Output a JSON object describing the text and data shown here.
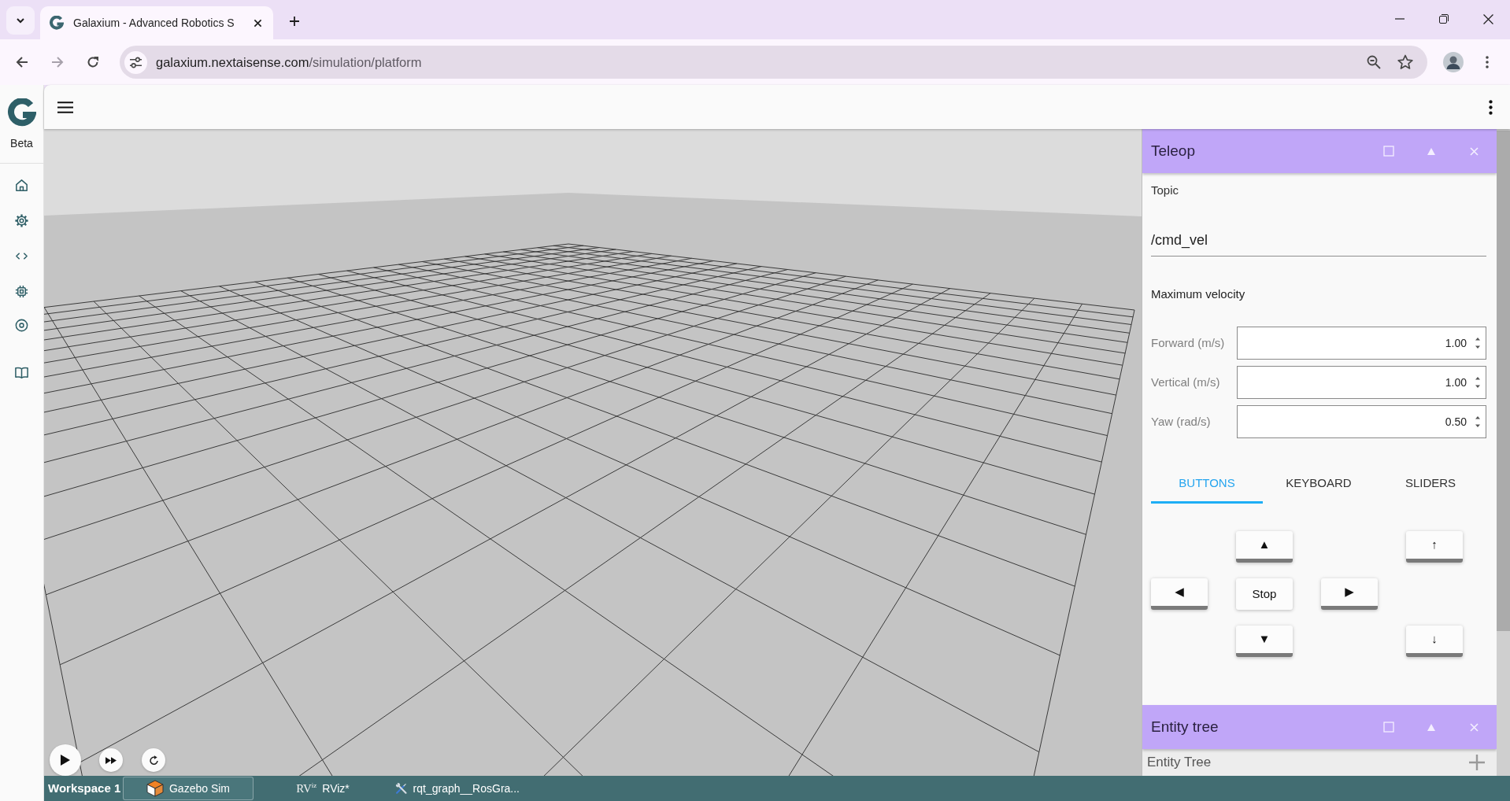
{
  "browser": {
    "tabs": [
      {
        "title": "Galaxium - Advanced Robotics S",
        "selected": true
      }
    ],
    "nav_buttons": [
      {
        "kind": "back",
        "disabled": false
      },
      {
        "kind": "forward",
        "disabled": true
      },
      {
        "kind": "reload",
        "disabled": false
      }
    ],
    "url": {
      "host": "galaxium.nextaisense.com",
      "path": "/simulation/platform"
    }
  },
  "sidebar": {
    "caption": "Beta"
  },
  "panels": [
    {
      "kind": "teleop",
      "title": "Teleop",
      "topic_label": "Topic",
      "topic": "/cmd_vel",
      "velocity_heading": "Maximum velocity",
      "velocities": [
        {
          "label": "Forward (m/s)",
          "value": "1.00"
        },
        {
          "label": "Vertical (m/s)",
          "value": "1.00"
        },
        {
          "label": "Yaw (rad/s)",
          "value": "0.50"
        }
      ],
      "tabs": [
        {
          "label": "BUTTONS",
          "selected": true
        },
        {
          "label": "KEYBOARD",
          "selected": false
        },
        {
          "label": "SLIDERS",
          "selected": false
        }
      ],
      "pad": [
        {
          "label": "▲",
          "kind": "key"
        },
        {
          "label": "↑",
          "kind": "key"
        },
        {
          "label": "◀",
          "kind": "key"
        },
        {
          "label": "Stop",
          "kind": "stop"
        },
        {
          "label": "▶",
          "kind": "key"
        },
        {
          "label": "▼",
          "kind": "key"
        },
        {
          "label": "↓",
          "kind": "key"
        }
      ]
    },
    {
      "kind": "entity_tree",
      "title": "Entity tree",
      "subtitle": "Entity Tree"
    }
  ],
  "taskbar": {
    "workspace": "Workspace 1",
    "items": [
      {
        "kind": "cube",
        "label": "Gazebo Sim",
        "selected": true
      },
      {
        "kind": "lettermark",
        "icon_text": "RV$^{iz}$",
        "label": "RViz*",
        "selected": false
      },
      {
        "kind": "tools",
        "label": "rqt_graph__RosGra...",
        "selected": false
      }
    ]
  }
}
